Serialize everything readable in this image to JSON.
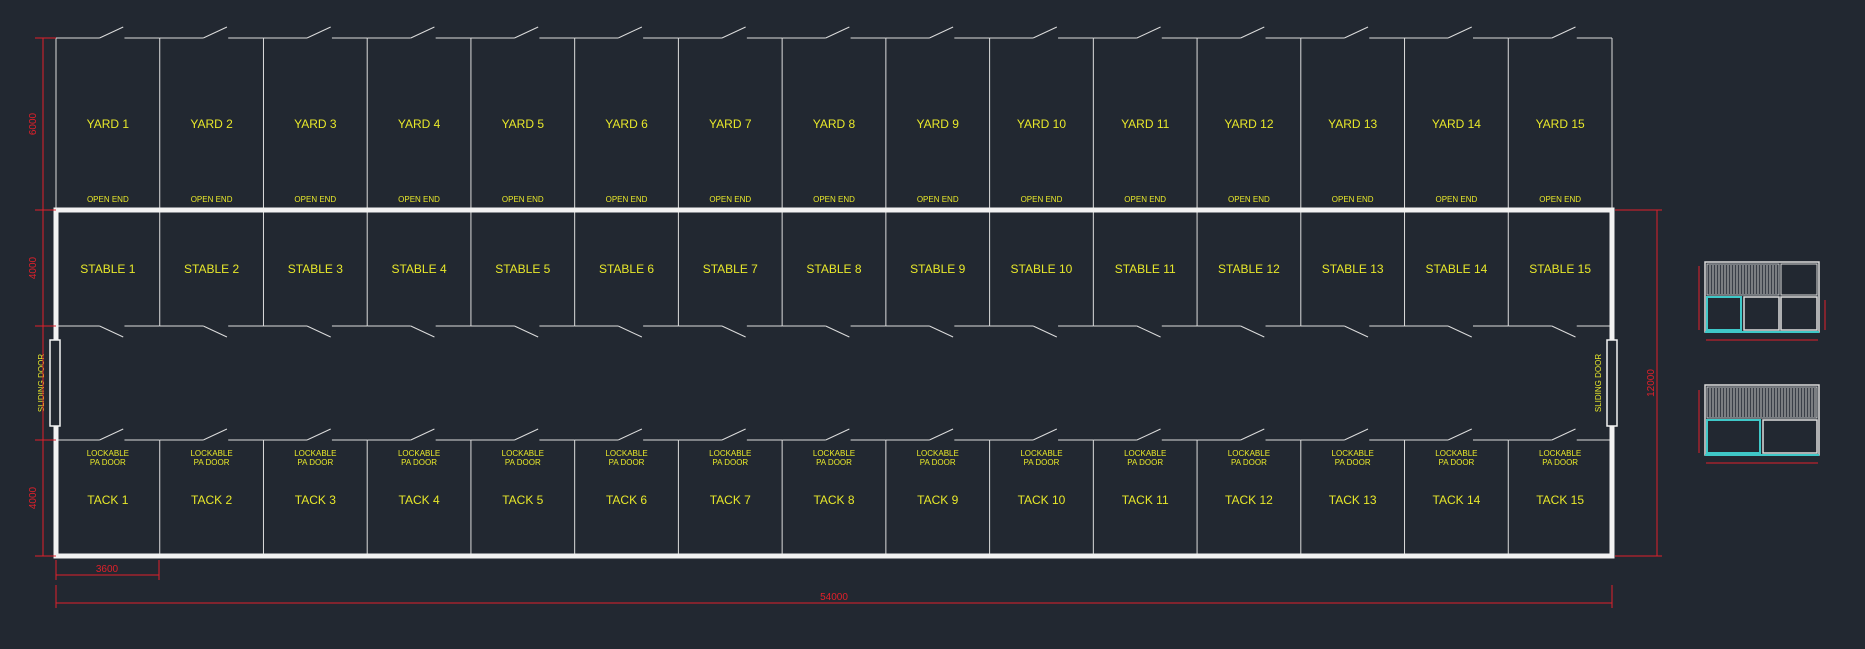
{
  "colors": {
    "background": "#222831",
    "label": "#e8e82a",
    "wall": "#dcdcdc",
    "dimension": "#e0202a",
    "accent": "#3fc8c8"
  },
  "bays": 15,
  "yards": [
    "YARD 1",
    "YARD 2",
    "YARD 3",
    "YARD 4",
    "YARD 5",
    "YARD 6",
    "YARD 7",
    "YARD 8",
    "YARD 9",
    "YARD 10",
    "YARD 11",
    "YARD 12",
    "YARD 13",
    "YARD 14",
    "YARD 15"
  ],
  "open_end": "OPEN END",
  "stables": [
    "STABLE 1",
    "STABLE 2",
    "STABLE 3",
    "STABLE 4",
    "STABLE 5",
    "STABLE 6",
    "STABLE 7",
    "STABLE 8",
    "STABLE 9",
    "STABLE 10",
    "STABLE 11",
    "STABLE 12",
    "STABLE 13",
    "STABLE 14",
    "STABLE 15"
  ],
  "tacks": [
    "TACK 1",
    "TACK 2",
    "TACK 3",
    "TACK 4",
    "TACK 5",
    "TACK 6",
    "TACK 7",
    "TACK 8",
    "TACK 9",
    "TACK 10",
    "TACK 11",
    "TACK 12",
    "TACK 13",
    "TACK 14",
    "TACK 15"
  ],
  "door_label_line1": "LOCKABLE",
  "door_label_line2": "PA DOOR",
  "sliding_door": "SLIDING DOOR",
  "dimensions": {
    "yard_depth": "6000",
    "stable_depth": "4000",
    "tack_depth": "4000",
    "bay_width": "3600",
    "total_length": "54000",
    "total_width": "12000"
  }
}
